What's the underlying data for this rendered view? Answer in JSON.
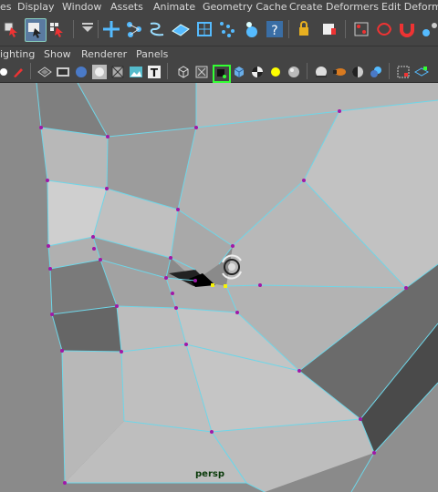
{
  "menubar": {
    "items": [
      "es",
      "Display",
      "Window",
      "Assets",
      "Animate",
      "Geometry Cache",
      "Create Deformers",
      "Edit Deformers"
    ]
  },
  "shelf": {
    "tools": [
      "select-tool-icon",
      "lasso-icon",
      "paint-select-icon",
      "snap-grid-icon",
      "move-tool-icon",
      "nodes-icon",
      "curve-icon",
      "plane-icon",
      "lattice-icon",
      "particles-icon",
      "fluid-icon",
      "help-icon",
      "lock-icon",
      "camera-icon",
      "cluster-icon",
      "ik-icon",
      "magnet-icon"
    ]
  },
  "panel_menu": {
    "items": [
      "ighting",
      "Show",
      "Renderer",
      "Panels"
    ]
  },
  "panel_tools": {
    "icons": [
      "cube-wire-icon",
      "image-plane-icon",
      "shaded-icon",
      "smooth-shade-icon",
      "wireframe-on-shaded-icon",
      "texture-icon",
      "xray-icon",
      "bounding-box-icon",
      "isolate-icon",
      "component-mode-icon",
      "cube-solid-icon",
      "checker-icon",
      "light-icon",
      "sphere-icon",
      "shadow-icon",
      "motion-blur-icon",
      "ao-icon",
      "multisample-icon",
      "resolution-gate-icon"
    ]
  },
  "viewport": {
    "camera": "persp",
    "colors": {
      "wire": "#6fd6e8",
      "vertex": "#a018a8",
      "selected": "#f4f20a",
      "bg": "#8a8a8a"
    }
  }
}
